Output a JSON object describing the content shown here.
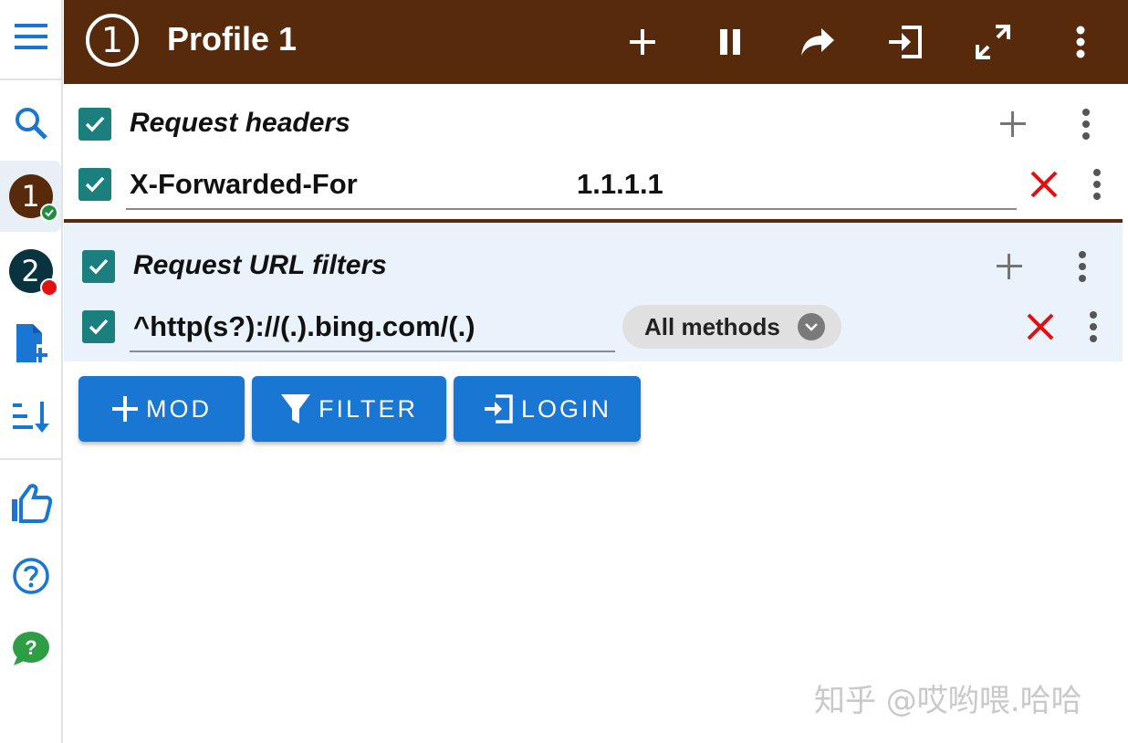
{
  "sidebar": {
    "profiles": [
      {
        "number": "1",
        "color": "#582a0c",
        "status": "enabled"
      },
      {
        "number": "2",
        "color": "#0a3340",
        "status": "disabled"
      }
    ]
  },
  "header": {
    "profile_number": "1",
    "title": "Profile 1"
  },
  "sections": [
    {
      "title": "Request headers",
      "checked": true,
      "rows": [
        {
          "name": "X-Forwarded-For",
          "value": "1.1.1.1",
          "checked": true
        }
      ]
    },
    {
      "title": "Request URL filters",
      "checked": true,
      "rows": [
        {
          "pattern": "^http(s?)://(.).bing.com/(.)",
          "method": "All methods",
          "checked": true
        }
      ]
    }
  ],
  "actions": {
    "mod_label": "MOD",
    "filter_label": "FILTER",
    "login_label": "LOGIN"
  },
  "watermark": "知乎 @哎哟喂.哈哈",
  "colors": {
    "header_bg": "#582a0c",
    "accent_blue": "#1976d2",
    "checkbox": "#1a7f7d",
    "delete_red": "#e01010",
    "filter_section_bg": "#eaf3fb"
  }
}
